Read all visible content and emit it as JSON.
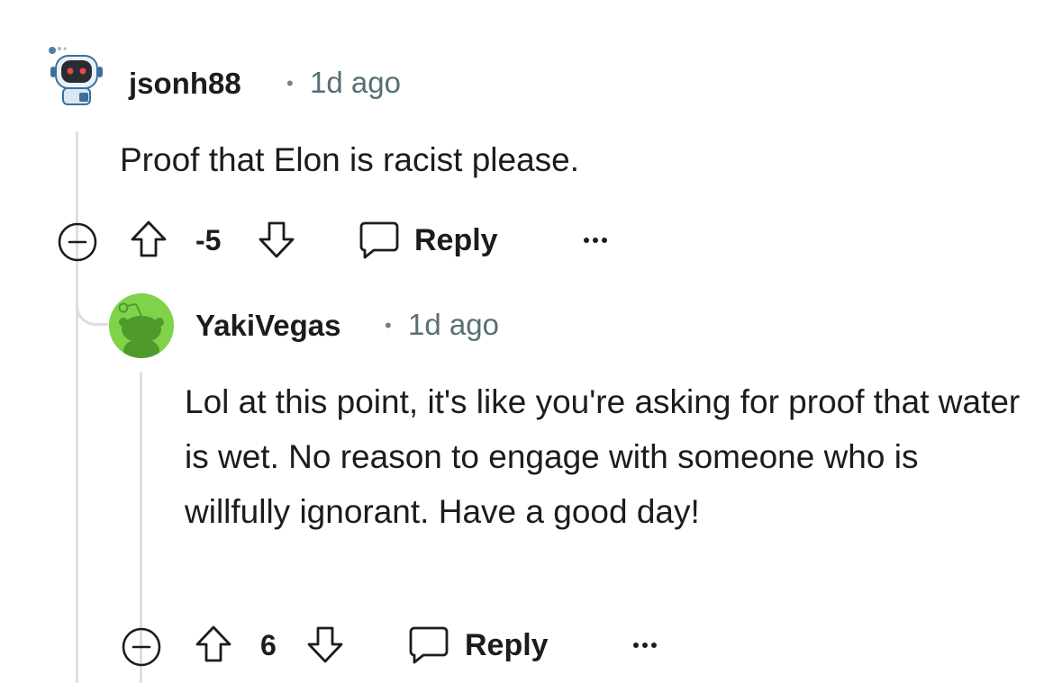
{
  "comments": [
    {
      "username": "jsonh88",
      "separator": "•",
      "time": "1d ago",
      "body": "Proof that Elon is racist please.",
      "score": "-5",
      "reply_label": "Reply",
      "avatar_icon": "robot-avatar-icon"
    },
    {
      "username": "YakiVegas",
      "separator": "•",
      "time": "1d ago",
      "body": "Lol at this point, it's like you're asking for proof that water is wet. No reason to engage with someone who is willfully ignorant. Have a good day!",
      "score": "6",
      "reply_label": "Reply",
      "avatar_icon": "snoo-avatar-icon",
      "avatar_color": "#7ed349"
    }
  ]
}
